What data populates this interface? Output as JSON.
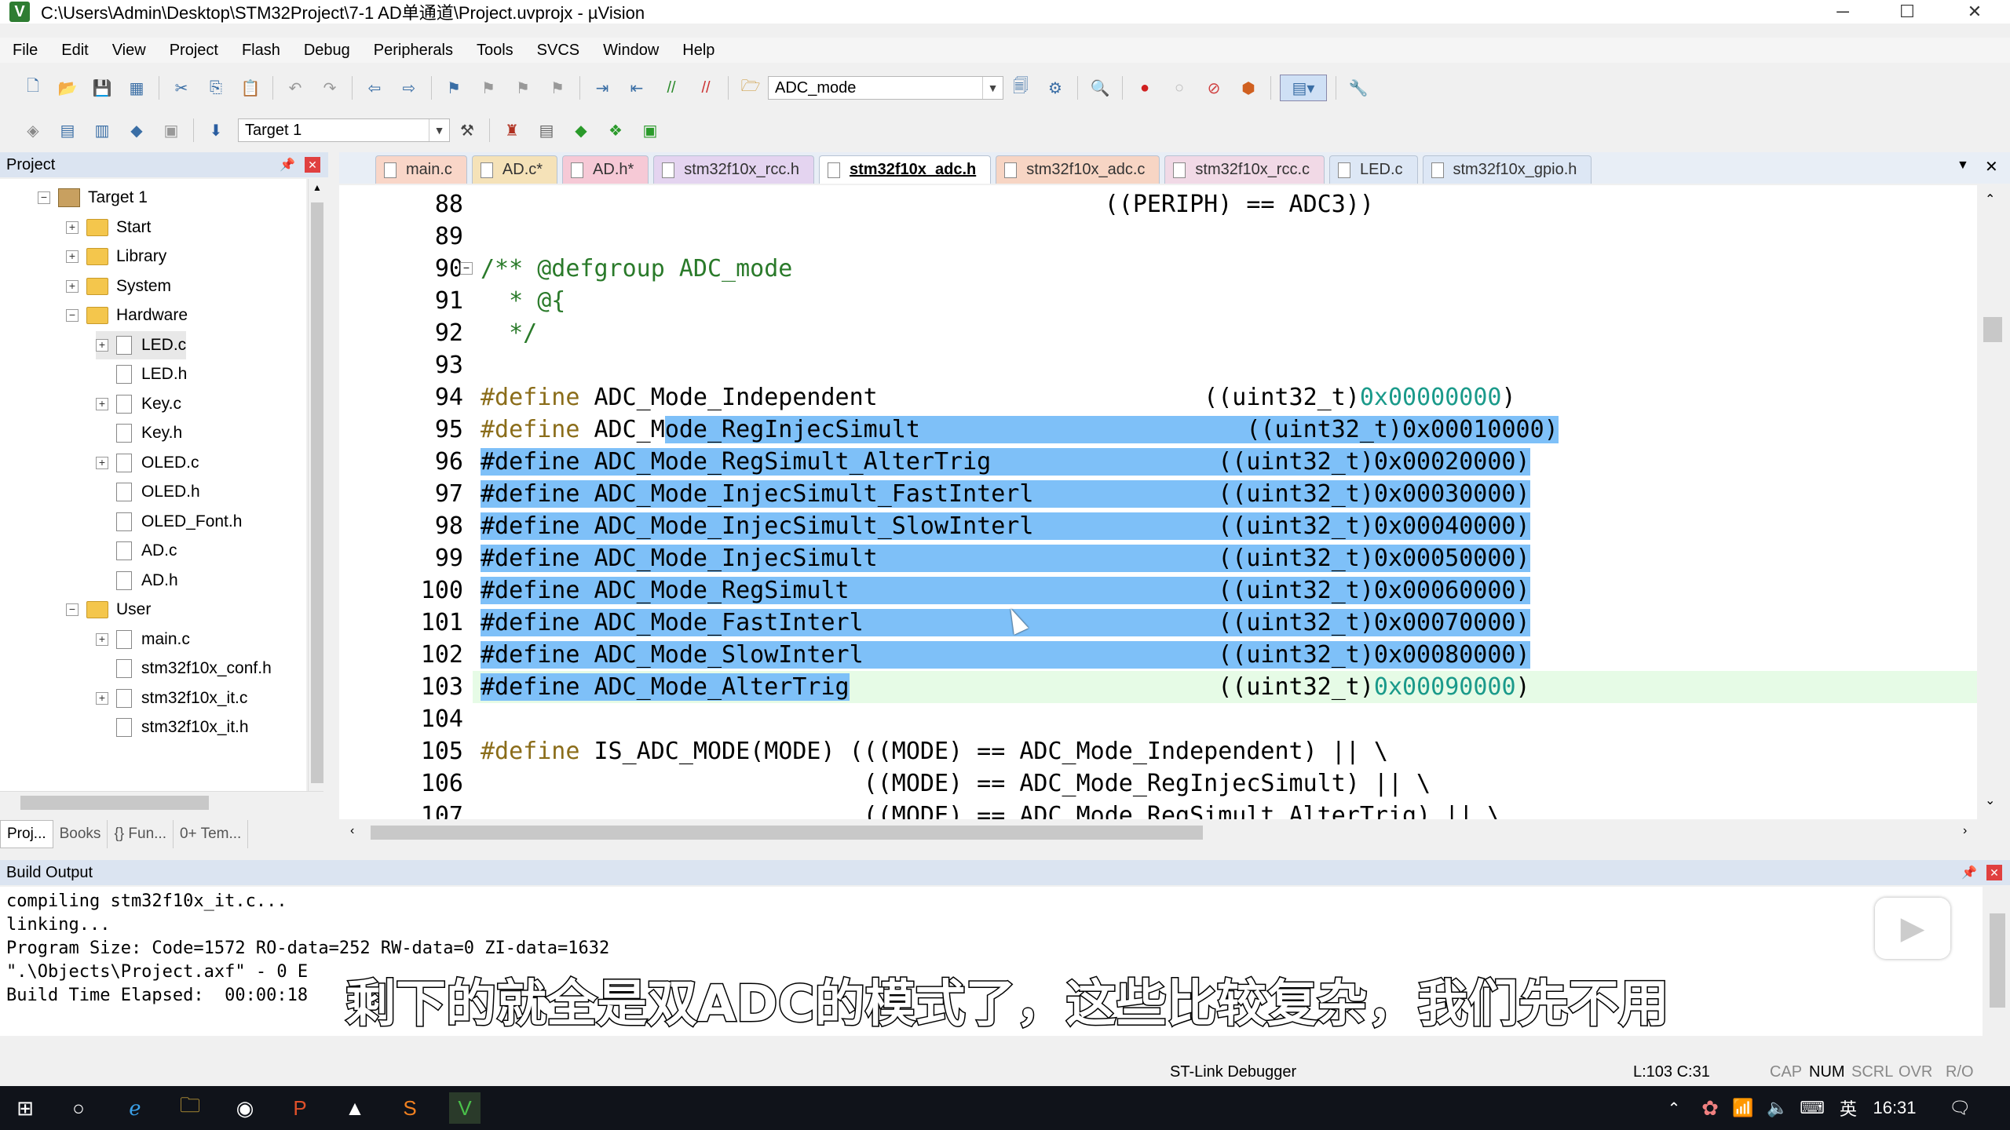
{
  "window": {
    "title": "C:\\Users\\Admin\\Desktop\\STM32Project\\7-1 AD单通道\\Project.uvprojx - µVision",
    "minimize": "─",
    "maximize": "☐",
    "close": "✕"
  },
  "menu": [
    "File",
    "Edit",
    "View",
    "Project",
    "Flash",
    "Debug",
    "Peripherals",
    "Tools",
    "SVCS",
    "Window",
    "Help"
  ],
  "toolbar": {
    "find_combo_value": "ADC_mode",
    "target_combo_value": "Target 1"
  },
  "project": {
    "header": "Project",
    "tree": [
      {
        "label": "Target 1",
        "level": 0,
        "kind": "target",
        "expander": "−"
      },
      {
        "label": "Start",
        "level": 1,
        "kind": "folder",
        "expander": "+"
      },
      {
        "label": "Library",
        "level": 1,
        "kind": "folder",
        "expander": "+"
      },
      {
        "label": "System",
        "level": 1,
        "kind": "folder",
        "expander": "+"
      },
      {
        "label": "Hardware",
        "level": 1,
        "kind": "folder",
        "expander": "−"
      },
      {
        "label": "LED.c",
        "level": 2,
        "kind": "file",
        "expander": "+"
      },
      {
        "label": "LED.h",
        "level": 2,
        "kind": "file",
        "expander": ""
      },
      {
        "label": "Key.c",
        "level": 2,
        "kind": "file",
        "expander": "+"
      },
      {
        "label": "Key.h",
        "level": 2,
        "kind": "file",
        "expander": ""
      },
      {
        "label": "OLED.c",
        "level": 2,
        "kind": "file",
        "expander": "+"
      },
      {
        "label": "OLED.h",
        "level": 2,
        "kind": "file",
        "expander": ""
      },
      {
        "label": "OLED_Font.h",
        "level": 2,
        "kind": "file",
        "expander": ""
      },
      {
        "label": "AD.c",
        "level": 2,
        "kind": "file",
        "expander": ""
      },
      {
        "label": "AD.h",
        "level": 2,
        "kind": "file",
        "expander": ""
      },
      {
        "label": "User",
        "level": 1,
        "kind": "folder",
        "expander": "−"
      },
      {
        "label": "main.c",
        "level": 2,
        "kind": "file",
        "expander": "+"
      },
      {
        "label": "stm32f10x_conf.h",
        "level": 2,
        "kind": "file",
        "expander": ""
      },
      {
        "label": "stm32f10x_it.c",
        "level": 2,
        "kind": "file",
        "expander": "+"
      },
      {
        "label": "stm32f10x_it.h",
        "level": 2,
        "kind": "file",
        "expander": ""
      }
    ],
    "bottom_tabs": [
      "Proj...",
      "Books",
      "{} Fun...",
      "0+ Tem..."
    ]
  },
  "editor": {
    "tabs": [
      {
        "label": "main.c",
        "active": false,
        "color": "#f9d6c8"
      },
      {
        "label": "AD.c*",
        "active": false,
        "color": "#f5e2b8"
      },
      {
        "label": "AD.h*",
        "active": false,
        "color": "#f6c9d6"
      },
      {
        "label": "stm32f10x_rcc.h",
        "active": false,
        "color": "#e4d4f0"
      },
      {
        "label": "stm32f10x_adc.h",
        "active": true,
        "color": "#ffffff"
      },
      {
        "label": "stm32f10x_adc.c",
        "active": false,
        "color": "#f7d5c4"
      },
      {
        "label": "stm32f10x_rcc.c",
        "active": false,
        "color": "#f1d9e6"
      },
      {
        "label": "LED.c",
        "active": false,
        "color": "#dde7f5"
      },
      {
        "label": "stm32f10x_gpio.h",
        "active": false,
        "color": "#dde7f5"
      }
    ],
    "lines": [
      {
        "n": "88",
        "segs": [
          {
            "t": "                                            ((PERIPH) == ADC3))",
            "c": ""
          }
        ]
      },
      {
        "n": "89",
        "segs": [
          {
            "t": "",
            "c": ""
          }
        ]
      },
      {
        "n": "90",
        "segs": [
          {
            "t": "/** @defgroup ADC_mode",
            "c": "cmt"
          }
        ]
      },
      {
        "n": "91",
        "segs": [
          {
            "t": "  * @{",
            "c": "cmt"
          }
        ]
      },
      {
        "n": "92",
        "segs": [
          {
            "t": "  */",
            "c": "cmt"
          }
        ]
      },
      {
        "n": "93",
        "segs": [
          {
            "t": "",
            "c": ""
          }
        ]
      },
      {
        "n": "94",
        "segs": [
          {
            "t": "#define",
            "c": "kw"
          },
          {
            "t": " ADC_Mode_Independent                       ((uint32_t)",
            "c": ""
          },
          {
            "t": "0x00000000",
            "c": "num"
          },
          {
            "t": ")",
            "c": ""
          }
        ]
      },
      {
        "n": "95",
        "segs": [
          {
            "t": "#define",
            "c": "kw"
          },
          {
            "t": " ADC_M",
            "c": ""
          },
          {
            "t": "ode_RegInjecSimult                       ((uint32_t)0x00010000)",
            "c": "sel"
          }
        ]
      },
      {
        "n": "96",
        "segs": [
          {
            "t": "#define ADC_Mode_RegSimult_AlterTrig                ((uint32_t)0x00020000)",
            "c": "sel"
          }
        ]
      },
      {
        "n": "97",
        "segs": [
          {
            "t": "#define ADC_Mode_InjecSimult_FastInterl             ((uint32_t)0x00030000)",
            "c": "sel"
          }
        ]
      },
      {
        "n": "98",
        "segs": [
          {
            "t": "#define ADC_Mode_InjecSimult_SlowInterl             ((uint32_t)0x00040000)",
            "c": "sel"
          }
        ]
      },
      {
        "n": "99",
        "segs": [
          {
            "t": "#define ADC_Mode_InjecSimult                        ((uint32_t)0x00050000)",
            "c": "sel"
          }
        ]
      },
      {
        "n": "100",
        "segs": [
          {
            "t": "#define ADC_Mode_RegSimult                          ((uint32_t)0x00060000)",
            "c": "sel"
          }
        ]
      },
      {
        "n": "101",
        "segs": [
          {
            "t": "#define ADC_Mode_FastInterl                         ((uint32_t)0x00070000)",
            "c": "sel"
          }
        ]
      },
      {
        "n": "102",
        "segs": [
          {
            "t": "#define ADC_Mode_SlowInterl                         ((uint32_t)0x00080000)",
            "c": "sel"
          }
        ]
      },
      {
        "n": "103",
        "segs": [
          {
            "t": "#define ADC_Mode_AlterTrig",
            "c": "sel"
          },
          {
            "t": "                          ((uint32_t)",
            "c": ""
          },
          {
            "t": "0x00090000",
            "c": "num"
          },
          {
            "t": ")",
            "c": ""
          }
        ]
      },
      {
        "n": "104",
        "segs": [
          {
            "t": "",
            "c": ""
          }
        ]
      },
      {
        "n": "105",
        "segs": [
          {
            "t": "#define",
            "c": "kw"
          },
          {
            "t": " IS_ADC_MODE(MODE) (((MODE) == ADC_Mode_Independent) || \\",
            "c": ""
          }
        ]
      },
      {
        "n": "106",
        "segs": [
          {
            "t": "                           ((MODE) == ADC_Mode_RegInjecSimult) || \\",
            "c": ""
          }
        ]
      },
      {
        "n": "107",
        "segs": [
          {
            "t": "                           ((MODE) == ADC_Mode_RegSimult_AlterTrig) || \\",
            "c": ""
          }
        ]
      }
    ]
  },
  "build_output": {
    "header": "Build Output",
    "lines": [
      "compiling stm32f10x_it.c...",
      "linking...",
      "Program Size: Code=1572 RO-data=252 RW-data=0 ZI-data=1632",
      "\".\\Objects\\Project.axf\" - 0 E",
      "Build Time Elapsed:  00:00:18"
    ],
    "subtitle": "剩下的就全是双ADC的模式了，这些比较复杂，我们先不用"
  },
  "status": {
    "debugger": "ST-Link Debugger",
    "position": "L:103 C:31",
    "flags": [
      "CAP",
      "NUM",
      "SCRL",
      "OVR",
      "R/O"
    ]
  },
  "taskbar": {
    "time": "16:31",
    "ime": "英"
  }
}
